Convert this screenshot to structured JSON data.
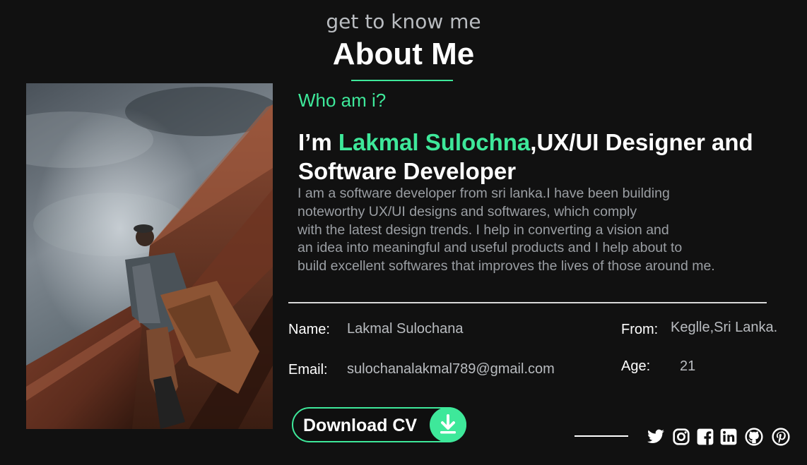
{
  "header": {
    "subtitle": "get to know me",
    "title": "About Me"
  },
  "intro": {
    "who": "Who am i?",
    "headline_prefix": "I’m ",
    "name": "Lakmal Sulochna",
    "headline_suffix": ",UX/UI Designer and",
    "headline_line2": "Software Developer"
  },
  "bio": [
    "I am a software developer from sri lanka.I have been building",
    "noteworthy UX/UI designs and softwares, which comply",
    "with the latest design trends. I help in converting a vision and",
    "an idea into meaningful and useful products and I help about to",
    "build excellent softwares that improves the lives of those around me."
  ],
  "details": {
    "name_label": "Name:",
    "name_value": "Lakmal Sulochana",
    "email_label": "Email:",
    "email_value": "sulochanalakmal789@gmail.com",
    "from_label": "From:",
    "from_value": "Keglle,Sri Lanka.",
    "age_label": "Age:",
    "age_value": "21"
  },
  "download": {
    "label": "Download CV",
    "icon": "download-icon"
  },
  "social": [
    "twitter-icon",
    "instagram-icon",
    "facebook-icon",
    "linkedin-icon",
    "github-icon",
    "pinterest-icon"
  ],
  "colors": {
    "accent": "#3ee89a",
    "background": "#111111",
    "muted_text": "#9a9ea3"
  }
}
